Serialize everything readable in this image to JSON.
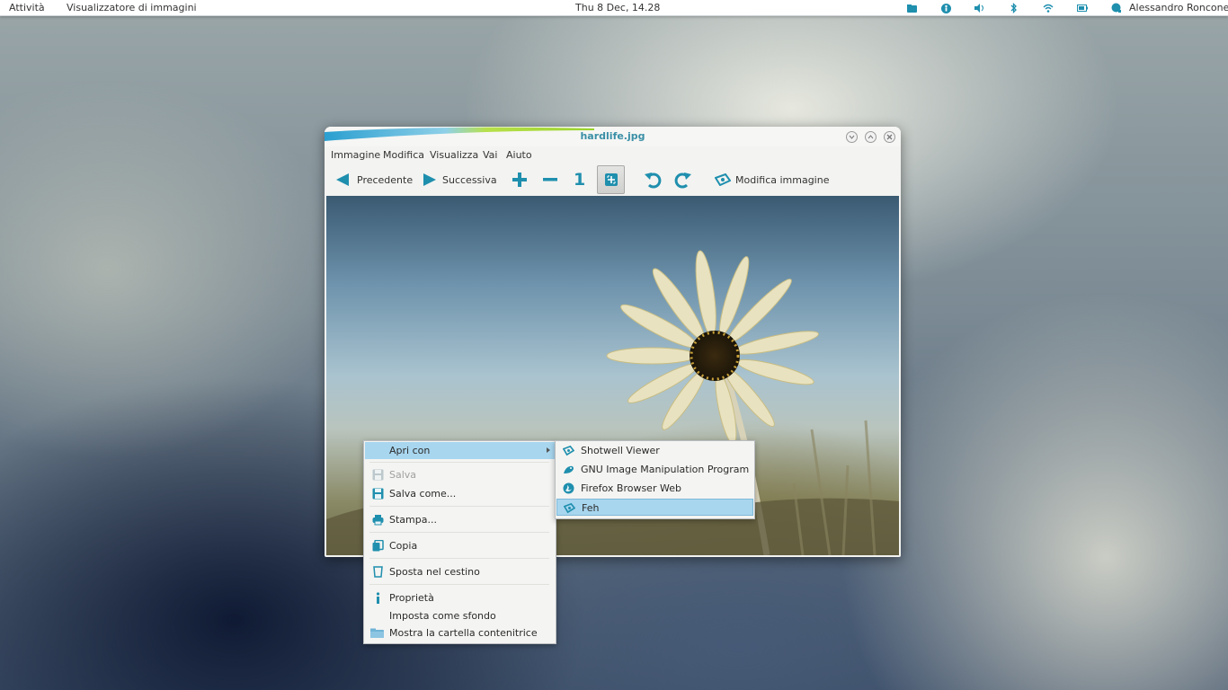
{
  "topbar": {
    "activities": "Attività",
    "app_name": "Visualizzatore di immagini",
    "clock": "Thu  8 Dec, 14.28",
    "user": "Alessandro Roncone",
    "tray_icons": [
      "folder-icon",
      "accessibility-icon",
      "volume-icon",
      "bluetooth-icon",
      "wifi-icon",
      "battery-icon",
      "chat-icon"
    ]
  },
  "window": {
    "title": "hardlife.jpg",
    "menu": [
      "Immagine",
      "Modifica",
      "Visualizza",
      "Vai",
      "Aiuto"
    ],
    "toolbar": {
      "prev": "Precedente",
      "next": "Successiva",
      "zoom_in": "+",
      "zoom_out": "−",
      "zoom_normal": "1",
      "edit": "Modifica immagine"
    }
  },
  "context_menu": {
    "items": [
      {
        "label": "Apri con",
        "icon": "",
        "has_submenu": true,
        "highlighted": true
      },
      {
        "label": "Salva",
        "icon": "save-icon",
        "disabled": true
      },
      {
        "label": "Salva come...",
        "icon": "save-as-icon"
      },
      {
        "label": "Stampa...",
        "icon": "printer-icon"
      },
      {
        "label": "Copia",
        "icon": "copy-icon"
      },
      {
        "label": "Sposta nel cestino",
        "icon": "trash-icon"
      },
      {
        "label": "Proprietà",
        "icon": "info-icon"
      },
      {
        "label": "Imposta come sfondo",
        "icon": ""
      },
      {
        "label": "Mostra la cartella contenitrice",
        "icon": "folder-icon"
      }
    ]
  },
  "submenu": {
    "items": [
      {
        "label": "Shotwell Viewer",
        "icon": "shotwell-icon"
      },
      {
        "label": "GNU Image Manipulation Program",
        "icon": "gimp-icon"
      },
      {
        "label": "Firefox Browser Web",
        "icon": "firefox-icon"
      },
      {
        "label": "Feh",
        "icon": "feh-icon",
        "highlighted": true
      }
    ]
  },
  "colors": {
    "accent": "#1f8fae",
    "highlight": "#a8d6ef",
    "title": "#3a8fa6"
  }
}
